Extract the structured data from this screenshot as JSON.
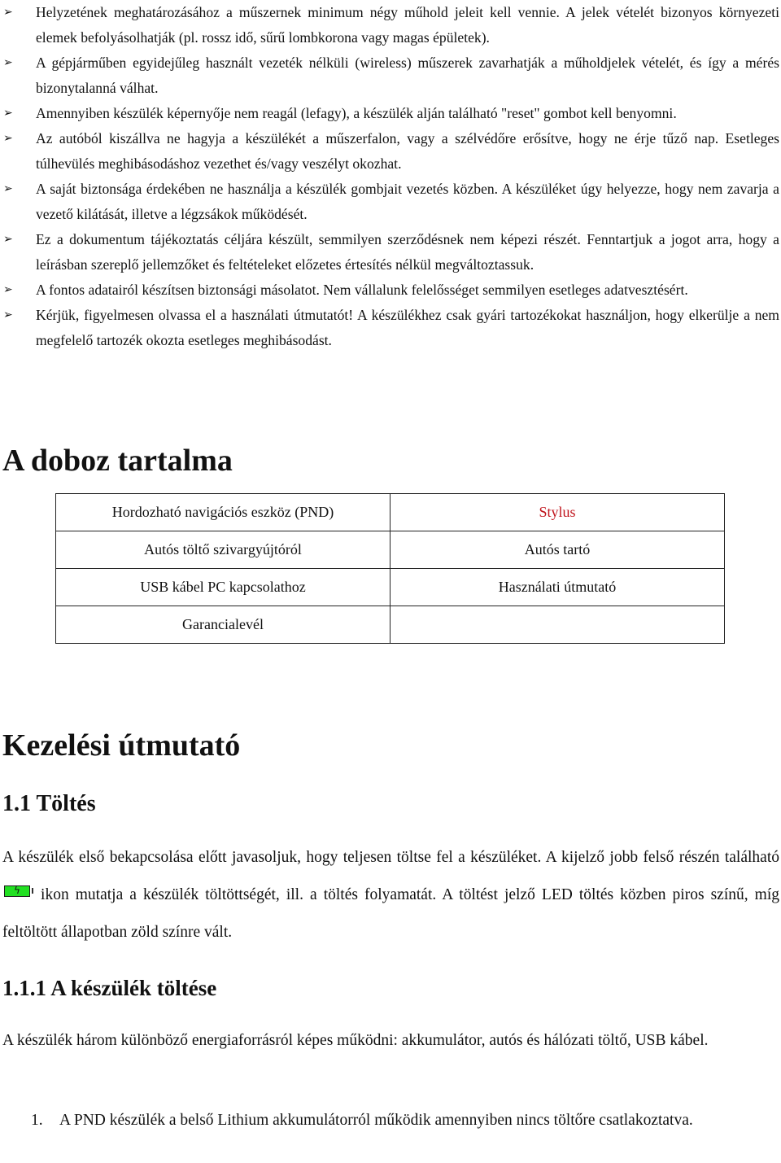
{
  "warnings": [
    {
      "marker_icon": "arrowhead-bullet",
      "text": "Helyzetének meghatározásához a műszernek minimum négy műhold jeleit kell vennie. A jelek vételét bizonyos környezeti elemek befolyásolhatják (pl. rossz idő, sűrű lombkorona vagy magas épületek)."
    },
    {
      "marker_icon": "arrowhead-bullet",
      "text": "A gépjárműben egyidejűleg használt vezeték nélküli (wireless) műszerek zavarhatják a műholdjelek vételét, és így a mérés bizonytalanná válhat."
    },
    {
      "marker_icon": "arrowhead-bullet",
      "text": "Amennyiben készülék képernyője nem reagál (lefagy), a készülék alján található \"reset\" gombot kell benyomni."
    },
    {
      "marker_icon": "arrowhead-bullet",
      "text": "Az autóból kiszállva ne hagyja a készülékét a műszerfalon, vagy a szélvédőre erősítve, hogy ne érje tűző nap. Esetleges túlhevülés meghibásodáshoz vezethet és/vagy veszélyt okozhat."
    },
    {
      "marker_icon": "arrowhead-bullet",
      "text": "A saját biztonsága érdekében ne használja a készülék gombjait vezetés közben. A készüléket úgy helyezze, hogy nem zavarja a vezető kilátását, illetve a légzsákok működését."
    },
    {
      "marker_icon": "arrowhead-bullet",
      "text": "Ez a dokumentum tájékoztatás céljára készült, semmilyen szerződésnek nem képezi részét. Fenntartjuk a jogot arra, hogy a leírásban szereplő jellemzőket és feltételeket előzetes értesítés nélkül megváltoztassuk."
    },
    {
      "marker_icon": "arrowhead-bullet",
      "text": "A fontos adatairól készítsen biztonsági másolatot. Nem vállalunk felelősséget semmilyen esetleges adatvesztésért."
    },
    {
      "marker_icon": "arrowhead-bullet",
      "text": "Kérjük, figyelmesen olvassa el a használati útmutatót! A készülékhez csak gyári tartozékokat használjon, hogy elkerülje a nem megfelelő tartozék okozta esetleges meghibásodást."
    }
  ],
  "box_contents": {
    "heading": "A doboz tartalma",
    "highlight_color": "#c0141c",
    "rows": [
      [
        "Hordozható navigációs eszköz (PND)",
        "Stylus"
      ],
      [
        "Autós töltő szivargyújtóról",
        "Autós tartó"
      ],
      [
        "USB kábel PC kapcsolathoz",
        "Használati útmutató"
      ],
      [
        "Garancialevél",
        ""
      ]
    ]
  },
  "manual": {
    "heading": "Kezelési útmutató",
    "charging": {
      "heading": "1.1 Töltés",
      "para_before_icon": "A készülék első bekapcsolása előtt javasoljuk, hogy teljesen töltse fel a készüléket. A kijelző jobb felső részén található",
      "icon": "battery-charging-icon",
      "icon_color": "#22e022",
      "para_after_icon": "ikon mutatja a készülék töltöttségét, ill. a töltés folyamatát. A töltést jelző LED töltés közben piros színű, míg feltöltött állapotban zöld színre vált."
    },
    "device_charging": {
      "heading": "1.1.1 A készülék töltése",
      "paragraph": "A készülék három különböző energiaforrásról képes működni: akkumulátor, autós és hálózati töltő, USB kábel.",
      "list": [
        {
          "number": "1.",
          "text": "A PND készülék a belső Lithium akkumulátorról működik amennyiben nincs töltőre csatlakoztatva."
        }
      ]
    }
  }
}
